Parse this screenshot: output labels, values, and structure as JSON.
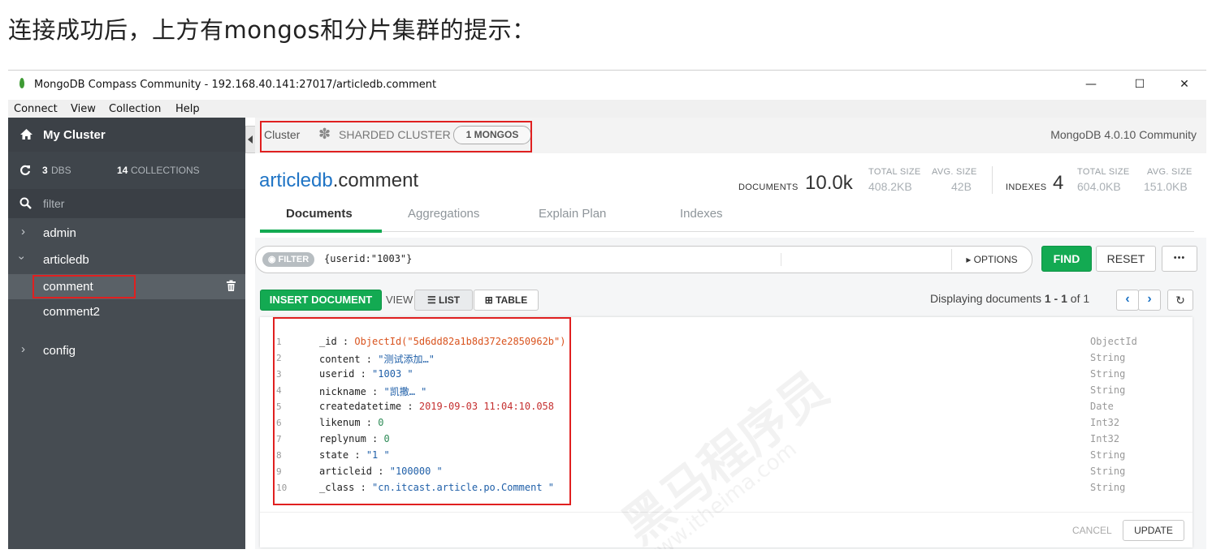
{
  "heading": "连接成功后，上方有mongos和分片集群的提示：",
  "window": {
    "title": "MongoDB Compass Community - 192.168.40.141:27017/articledb.comment",
    "minimize": "—",
    "maximize": "☐",
    "close": "✕"
  },
  "menu": [
    "Connect",
    "View",
    "Collection",
    "Help"
  ],
  "sidebar": {
    "cluster_name": "My Cluster",
    "dbs_count": "3",
    "dbs_label": "DBS",
    "collections_count": "14",
    "collections_label": "COLLECTIONS",
    "filter_placeholder": "filter",
    "databases": [
      {
        "name": "admin",
        "expanded": false
      },
      {
        "name": "articledb",
        "expanded": true,
        "collections": [
          "comment",
          "comment2"
        ]
      },
      {
        "name": "config",
        "expanded": false
      }
    ]
  },
  "topbar": {
    "cluster_label": "Cluster",
    "topology": "SHARDED CLUSTER",
    "mongos_badge": "1 MONGOS",
    "version": "MongoDB 4.0.10 Community"
  },
  "namespace": {
    "db": "articledb",
    "collection": ".comment"
  },
  "stats": {
    "documents_label": "DOCUMENTS",
    "documents_value": "10.0k",
    "total_size_label": "TOTAL SIZE",
    "total_size_value": "408.2KB",
    "avg_size_label": "AVG. SIZE",
    "avg_size_value": "42B",
    "indexes_label": "INDEXES",
    "indexes_value": "4",
    "idx_total_size_label": "TOTAL SIZE",
    "idx_total_size_value": "604.0KB",
    "idx_avg_size_label": "AVG. SIZE",
    "idx_avg_size_value": "151.0KB"
  },
  "tabs": [
    "Documents",
    "Aggregations",
    "Explain Plan",
    "Indexes"
  ],
  "query": {
    "filter_label": "FILTER",
    "filter_value": "{userid:\"1003\"}",
    "options_label": "OPTIONS",
    "find_label": "FIND",
    "reset_label": "RESET",
    "more_label": "•••"
  },
  "toolbar": {
    "insert_label": "INSERT DOCUMENT",
    "view_label": "VIEW",
    "list_label": "LIST",
    "table_label": "TABLE",
    "displaying_prefix": "Displaying documents",
    "range_start": "1",
    "range_sep": "-",
    "range_end": "1",
    "of_label": "of",
    "total": "1"
  },
  "document": {
    "fields": [
      {
        "line": "1",
        "key": "_id",
        "value": "ObjectId(\"5d6dd82a1b8d372e2850962b\")",
        "type": "ObjectId",
        "kind": "oid"
      },
      {
        "line": "2",
        "key": "content",
        "value": "\"测试添加…\"",
        "type": "String",
        "kind": "str"
      },
      {
        "line": "3",
        "key": "userid",
        "value": "\"1003  \"",
        "type": "String",
        "kind": "str"
      },
      {
        "line": "4",
        "key": "nickname",
        "value": "\"凯撒…  \"",
        "type": "String",
        "kind": "str"
      },
      {
        "line": "5",
        "key": "createdatetime",
        "value": "2019-09-03 11:04:10.058",
        "type": "Date",
        "kind": "date"
      },
      {
        "line": "6",
        "key": "likenum",
        "value": "0",
        "type": "Int32",
        "kind": "num"
      },
      {
        "line": "7",
        "key": "replynum",
        "value": "0",
        "type": "Int32",
        "kind": "num"
      },
      {
        "line": "8",
        "key": "state",
        "value": "\"1  \"",
        "type": "String",
        "kind": "str"
      },
      {
        "line": "9",
        "key": "articleid",
        "value": "\"100000  \"",
        "type": "String",
        "kind": "str"
      },
      {
        "line": "10",
        "key": "_class",
        "value": "\"cn.itcast.article.po.Comment     \"",
        "type": "String",
        "kind": "str"
      }
    ],
    "cancel_label": "CANCEL",
    "update_label": "UPDATE"
  },
  "watermark": {
    "brand": "黑马程序员",
    "site": "www.itheima.com"
  },
  "colors": {
    "accent_green": "#13aa52",
    "sidebar_bg": "#464c52",
    "highlight_red": "#e02020",
    "link_blue": "#1f74c5"
  }
}
